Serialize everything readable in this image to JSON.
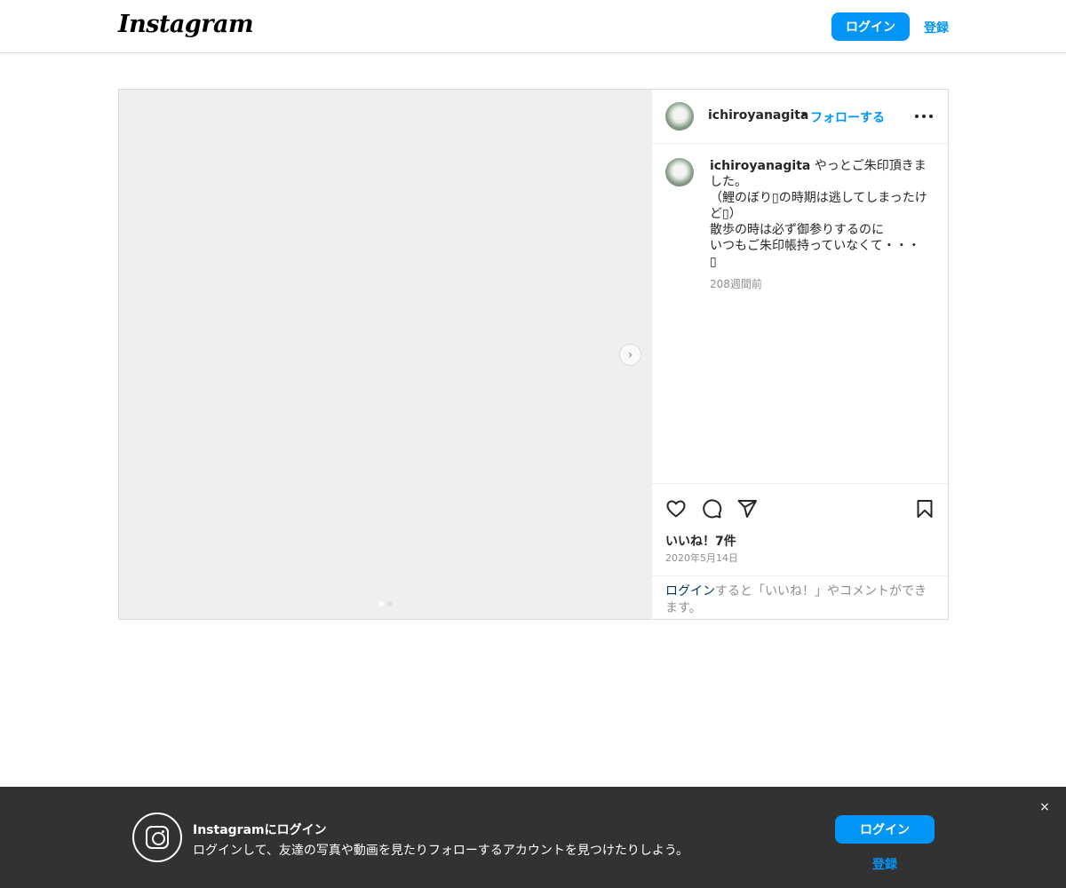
{
  "nav": {
    "logo": "Instagram",
    "login_label": "ログイン",
    "signup_label": "登録"
  },
  "post": {
    "username": "ichiroyanagita",
    "separator": "•",
    "follow_label": "フォローする",
    "caption": "やっとご朱印頂きました。\n（鯉のぼり▯の時期は逃してしまったけど▯）\n散歩の時は必ず御参りするのに\nいつもご朱印帳持っていなくて・・・\n▯",
    "caption_time": "208週間前",
    "likes": "いいね！7件",
    "date": "2020年5月14日",
    "login_note_link": "ログイン",
    "login_note_text": "すると「いいね！」やコメントができます。",
    "carousel": {
      "slide_count": 2,
      "active_index": 0
    }
  },
  "icons": {
    "like": "heart-icon",
    "comment": "comment-icon",
    "share": "share-icon",
    "save": "bookmark-icon",
    "more": "more-icon",
    "next": "chevron-right-icon",
    "close": "close-icon",
    "brand": "instagram-icon"
  },
  "banner": {
    "title": "Instagramにログイン",
    "subtitle": "ログインして、友達の写真や動画を見たりフォローするアカウントを見つけたりしよう。",
    "login_label": "ログイン",
    "signup_label": "登録",
    "close_glyph": "×"
  },
  "colors": {
    "accent": "#0095f6",
    "banner_bg": "#323232",
    "link_dark": "#00376b"
  }
}
